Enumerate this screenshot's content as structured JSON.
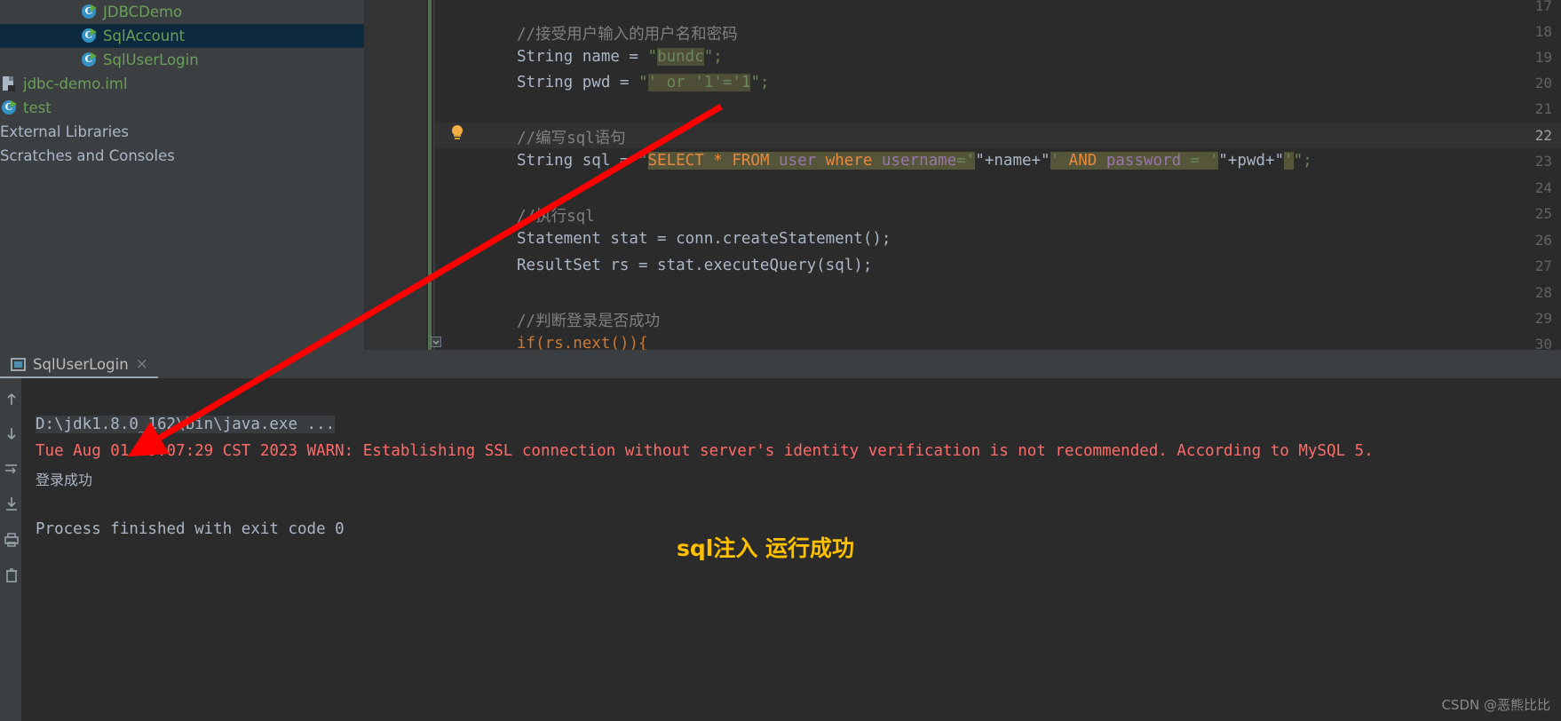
{
  "project_tree": {
    "items": [
      {
        "label": "JDBCDemo",
        "icon": "java-class-icon",
        "selected": false,
        "indent": 3,
        "style": "green"
      },
      {
        "label": "SqlAccount",
        "icon": "java-class-icon",
        "selected": true,
        "indent": 3,
        "style": "green"
      },
      {
        "label": "SqlUserLogin",
        "icon": "java-class-icon",
        "selected": false,
        "indent": 3,
        "style": "green"
      },
      {
        "label": "jdbc-demo.iml",
        "icon": "iml-file-icon",
        "selected": false,
        "indent": 1,
        "style": "green"
      },
      {
        "label": "test",
        "icon": "java-class-icon",
        "selected": false,
        "indent": 1,
        "style": "green"
      },
      {
        "label": "External Libraries",
        "icon": "none",
        "selected": false,
        "indent": 0,
        "style": "plain"
      },
      {
        "label": "Scratches and Consoles",
        "icon": "none",
        "selected": false,
        "indent": 0,
        "style": "plain"
      }
    ]
  },
  "editor": {
    "line_numbers": [
      "17",
      "18",
      "19",
      "20",
      "21",
      "22",
      "23",
      "24",
      "25",
      "26",
      "27",
      "28",
      "29",
      "30"
    ],
    "current_line": "22",
    "lines": {
      "l18_comment": "//接受用户输入的用户名和密码",
      "l19": {
        "type_kw": "String",
        "name": " name = ",
        "quote": "\"",
        "value": "bundc",
        "tail": "\";"
      },
      "l20": {
        "type_kw": "String",
        "name": " pwd = ",
        "quote": "\"",
        "value": "' or '1'='1",
        "tail": "\";"
      },
      "l22_comment": "//编写sql语句",
      "l23": {
        "decl": "String sql = ",
        "sql_open": "\"",
        "sql_part1_kw": "SELECT * FROM",
        "sql_part1_tbl": " user ",
        "sql_where": "where",
        "sql_col": " username",
        "sql_eq": "='",
        "concat_name": "\"+name+\"",
        "sql_quote2": "' ",
        "sql_and": "AND",
        "sql_col2": " password",
        "sql_eq2": " = '",
        "concat_pwd": "\"+pwd+\"",
        "sql_end": "'",
        "tail": "\";"
      },
      "l25_comment": "//执行sql",
      "l26": "Statement stat = conn.createStatement();",
      "l27": "ResultSet rs = stat.executeQuery(sql);",
      "l29_comment": "//判断登录是否成功",
      "l30": "if(rs.next()){"
    }
  },
  "console": {
    "tab_label": "SqlUserLogin",
    "close_icon": "×",
    "toolbar_icons": [
      "scroll-up-icon",
      "scroll-down-icon",
      "soft-wrap-icon",
      "scroll-to-end-icon",
      "print-icon",
      "clear-all-icon"
    ],
    "lines": [
      {
        "id": "command",
        "text": "D:\\jdk1.8.0_162\\bin\\java.exe ...",
        "kind": "command"
      },
      {
        "id": "warning",
        "text": "Tue Aug 01 19:07:29 CST 2023 WARN: Establishing SSL connection without server's identity verification is not recommended. According to MySQL 5.",
        "kind": "warn"
      },
      {
        "id": "output",
        "text": "登录成功",
        "kind": "out"
      },
      {
        "id": "exit",
        "text": "Process finished with exit code 0",
        "kind": "exit"
      }
    ]
  },
  "annotation": {
    "text": "sql注入 运行成功",
    "color": "#ffc000",
    "arrow_color": "#ff0000"
  },
  "watermark": {
    "text": "CSDN @恶熊比比"
  },
  "colors": {
    "editor_bg": "#2b2b2b",
    "panel_bg": "#3c3f41",
    "selection_bg": "#0d293e",
    "keyword": "#cc7832",
    "string": "#6a8759",
    "comment": "#808080",
    "field": "#9876aa",
    "warn_red": "#ff6b68"
  }
}
